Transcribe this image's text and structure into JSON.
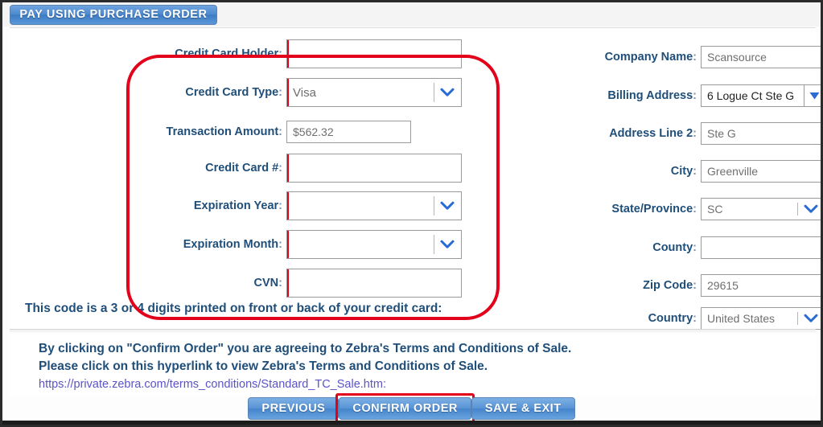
{
  "tab": {
    "label": "PAY USING PURCHASE ORDER"
  },
  "left_fields": [
    {
      "label": "Credit Card Holder",
      "value": "",
      "type": "text",
      "required": true,
      "name": "credit-card-holder"
    },
    {
      "label": "Credit Card Type",
      "value": "Visa",
      "type": "select",
      "required": true,
      "name": "credit-card-type"
    },
    {
      "label": "Transaction Amount",
      "value": "$562.32",
      "type": "text",
      "required": false,
      "name": "transaction-amount"
    },
    {
      "label": "Credit Card #",
      "value": "",
      "type": "text",
      "required": true,
      "name": "credit-card-number"
    },
    {
      "label": "Expiration Year",
      "value": "",
      "type": "select",
      "required": true,
      "name": "expiration-year"
    },
    {
      "label": "Expiration Month",
      "value": "",
      "type": "select",
      "required": true,
      "name": "expiration-month"
    },
    {
      "label": "CVN",
      "value": "",
      "type": "text",
      "required": true,
      "name": "cvn"
    }
  ],
  "right_fields": [
    {
      "label": "Company Name",
      "value": "Scansource",
      "type": "text",
      "name": "company-name"
    },
    {
      "label": "Billing Address",
      "value": "6 Logue Ct Ste G",
      "type": "combo",
      "name": "billing-address"
    },
    {
      "label": "Address Line 2",
      "value": "Ste G",
      "type": "text",
      "name": "address-line-2"
    },
    {
      "label": "City",
      "value": "Greenville",
      "type": "text",
      "name": "city"
    },
    {
      "label": "State/Province",
      "value": "SC",
      "type": "select",
      "name": "state-province"
    },
    {
      "label": "County",
      "value": "",
      "type": "text",
      "name": "county"
    },
    {
      "label": "Zip Code",
      "value": "29615",
      "type": "text",
      "name": "zip-code"
    },
    {
      "label": "Country",
      "value": "United States",
      "type": "select",
      "name": "country"
    }
  ],
  "cvn_hint": "This code is a 3 or 4 digits printed on front or back of your credit card:",
  "terms": {
    "line1": "By clicking on \"Confirm Order\" you are agreeing to Zebra's Terms and Conditions of Sale.",
    "line2": "Please click on this hyperlink to view Zebra's Terms and Conditions of Sale.",
    "link": "https://private.zebra.com/terms_conditions/Standard_TC_Sale.htm:"
  },
  "buttons": [
    {
      "label": "PREVIOUS",
      "name": "previous-button",
      "highlighted": false
    },
    {
      "label": "CONFIRM ORDER",
      "name": "confirm-order-button",
      "highlighted": true
    },
    {
      "label": "SAVE & EXIT",
      "name": "save-and-exit-button",
      "highlighted": false
    }
  ],
  "colors": {
    "label_blue": "#1f4e79",
    "annotation_red": "#e2001a",
    "button_blue": "#4585cc",
    "link_purple": "#5b53c8",
    "required_marker": "#e2001a"
  }
}
